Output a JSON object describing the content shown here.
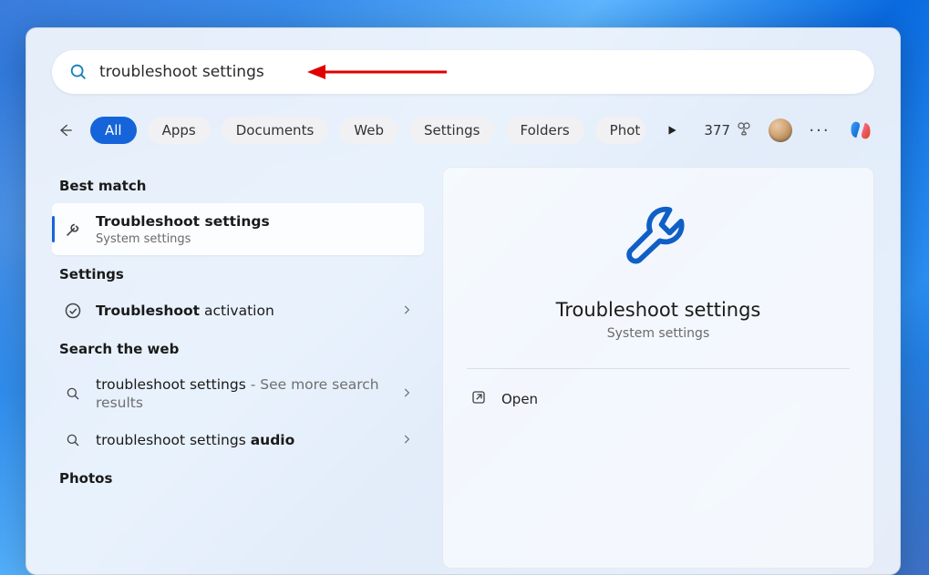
{
  "search": {
    "query": "troubleshoot settings"
  },
  "filters": {
    "items": [
      "All",
      "Apps",
      "Documents",
      "Web",
      "Settings",
      "Folders",
      "Phot"
    ],
    "active_index": 0
  },
  "header": {
    "points": "377"
  },
  "sections": {
    "best_match": {
      "label": "Best match",
      "item": {
        "title": "Troubleshoot settings",
        "subtitle": "System settings"
      }
    },
    "settings": {
      "label": "Settings",
      "items": [
        {
          "bold": "Troubleshoot",
          "rest": " activation"
        }
      ]
    },
    "search_web": {
      "label": "Search the web",
      "items": [
        {
          "bold": "troubleshoot settings",
          "muted": " - See more search results"
        },
        {
          "pre": "troubleshoot settings ",
          "bold": "audio"
        }
      ]
    },
    "photos": {
      "label": "Photos"
    }
  },
  "preview": {
    "title": "Troubleshoot settings",
    "subtitle": "System settings",
    "open_label": "Open"
  }
}
